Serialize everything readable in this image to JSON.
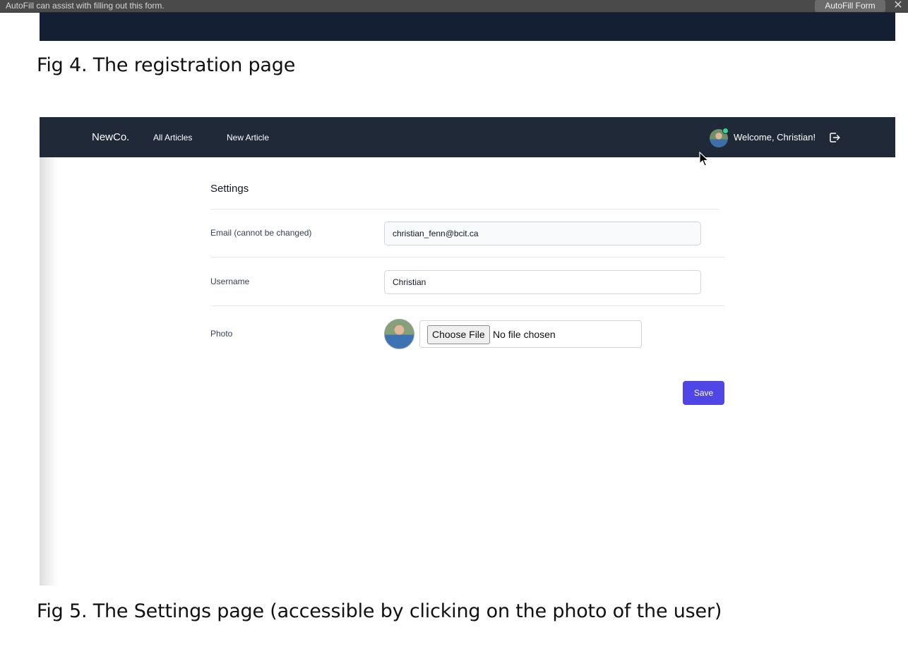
{
  "autofill": {
    "message": "AutoFill can assist with filling out this form.",
    "button": "AutoFill Form",
    "close_glyph": "✕"
  },
  "captions": {
    "fig4": "Fig 4. The registration page",
    "fig5": "Fig 5. The Settings page (accessible by clicking on the photo of the user)"
  },
  "navbar": {
    "brand": "NewCo.",
    "links": [
      "All Articles",
      "New Article"
    ],
    "welcome": "Welcome, Christian!",
    "avatar_icon": "user-avatar",
    "logout_icon": "logout-icon",
    "background": "#1f2937",
    "status_color": "#34d399"
  },
  "settings": {
    "title": "Settings",
    "email_label": "Email (cannot be changed)",
    "email_value": "christian_fenn@bcit.ca",
    "username_label": "Username",
    "username_value": "Christian",
    "photo_label": "Photo",
    "choose_file": "Choose File",
    "no_file": "No file chosen",
    "save": "Save",
    "accent": "#4f46e5"
  }
}
